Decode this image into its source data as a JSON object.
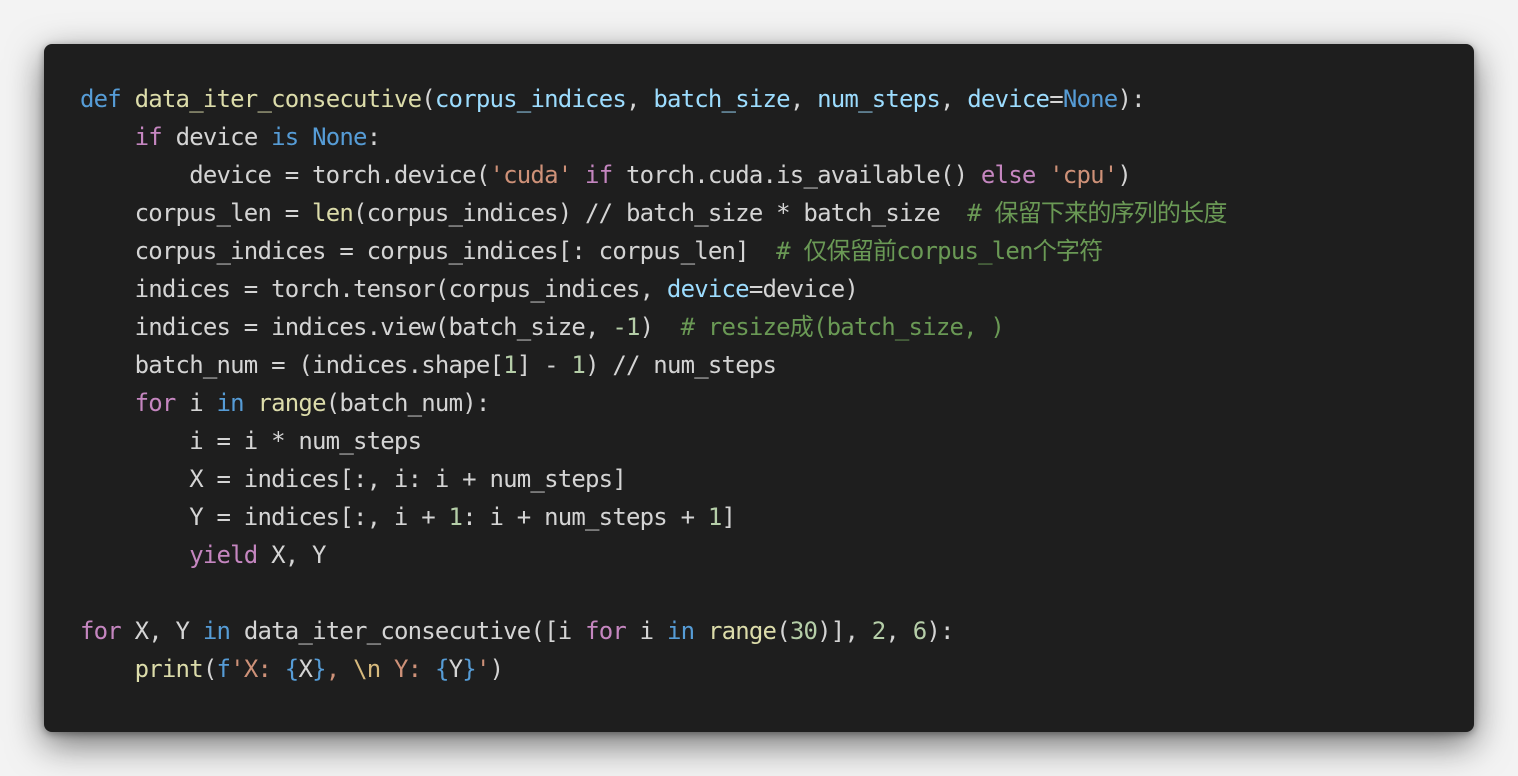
{
  "colors": {
    "page_background": "#f3f3f3",
    "editor_background": "#1e1e1e",
    "default_text": "#d4d4d4",
    "keyword": "#569cd6",
    "control": "#c586c0",
    "function": "#dcdcaa",
    "parameter": "#9cdcfe",
    "string": "#ce9178",
    "number": "#b5cea8",
    "comment": "#6a9955",
    "escape": "#d7ba7d"
  },
  "code": {
    "language": "python",
    "lines": [
      [
        {
          "t": "keyword",
          "v": "def"
        },
        {
          "t": "default",
          "v": " "
        },
        {
          "t": "function",
          "v": "data_iter_consecutive"
        },
        {
          "t": "default",
          "v": "("
        },
        {
          "t": "param",
          "v": "corpus_indices"
        },
        {
          "t": "default",
          "v": ", "
        },
        {
          "t": "param",
          "v": "batch_size"
        },
        {
          "t": "default",
          "v": ", "
        },
        {
          "t": "param",
          "v": "num_steps"
        },
        {
          "t": "default",
          "v": ", "
        },
        {
          "t": "param",
          "v": "device"
        },
        {
          "t": "default",
          "v": "="
        },
        {
          "t": "constant",
          "v": "None"
        },
        {
          "t": "default",
          "v": "):"
        }
      ],
      [
        {
          "t": "default",
          "v": "    "
        },
        {
          "t": "control",
          "v": "if"
        },
        {
          "t": "default",
          "v": " device "
        },
        {
          "t": "keyword",
          "v": "is"
        },
        {
          "t": "default",
          "v": " "
        },
        {
          "t": "constant",
          "v": "None"
        },
        {
          "t": "default",
          "v": ":"
        }
      ],
      [
        {
          "t": "default",
          "v": "        device = torch.device("
        },
        {
          "t": "string",
          "v": "'cuda'"
        },
        {
          "t": "default",
          "v": " "
        },
        {
          "t": "control",
          "v": "if"
        },
        {
          "t": "default",
          "v": " torch.cuda.is_available() "
        },
        {
          "t": "control",
          "v": "else"
        },
        {
          "t": "default",
          "v": " "
        },
        {
          "t": "string",
          "v": "'cpu'"
        },
        {
          "t": "default",
          "v": ")"
        }
      ],
      [
        {
          "t": "default",
          "v": "    corpus_len = "
        },
        {
          "t": "function",
          "v": "len"
        },
        {
          "t": "default",
          "v": "(corpus_indices) // batch_size * batch_size  "
        },
        {
          "t": "comment",
          "v": "# 保留下来的序列的长度"
        }
      ],
      [
        {
          "t": "default",
          "v": "    corpus_indices = corpus_indices[: corpus_len]  "
        },
        {
          "t": "comment",
          "v": "# 仅保留前corpus_len个字符"
        }
      ],
      [
        {
          "t": "default",
          "v": "    indices = torch.tensor(corpus_indices, "
        },
        {
          "t": "param",
          "v": "device"
        },
        {
          "t": "default",
          "v": "=device)"
        }
      ],
      [
        {
          "t": "default",
          "v": "    indices = indices.view(batch_size, "
        },
        {
          "t": "number",
          "v": "-1"
        },
        {
          "t": "default",
          "v": ")  "
        },
        {
          "t": "comment",
          "v": "# resize成(batch_size, )"
        }
      ],
      [
        {
          "t": "default",
          "v": "    batch_num = (indices.shape["
        },
        {
          "t": "number",
          "v": "1"
        },
        {
          "t": "default",
          "v": "] - "
        },
        {
          "t": "number",
          "v": "1"
        },
        {
          "t": "default",
          "v": ") // num_steps"
        }
      ],
      [
        {
          "t": "default",
          "v": "    "
        },
        {
          "t": "control",
          "v": "for"
        },
        {
          "t": "default",
          "v": " i "
        },
        {
          "t": "keyword",
          "v": "in"
        },
        {
          "t": "default",
          "v": " "
        },
        {
          "t": "function",
          "v": "range"
        },
        {
          "t": "default",
          "v": "(batch_num):"
        }
      ],
      [
        {
          "t": "default",
          "v": "        i = i * num_steps"
        }
      ],
      [
        {
          "t": "default",
          "v": "        X = indices[:, i: i + num_steps]"
        }
      ],
      [
        {
          "t": "default",
          "v": "        Y = indices[:, i + "
        },
        {
          "t": "number",
          "v": "1"
        },
        {
          "t": "default",
          "v": ": i + num_steps + "
        },
        {
          "t": "number",
          "v": "1"
        },
        {
          "t": "default",
          "v": "]"
        }
      ],
      [
        {
          "t": "default",
          "v": "        "
        },
        {
          "t": "control",
          "v": "yield"
        },
        {
          "t": "default",
          "v": " X, Y"
        }
      ],
      [
        {
          "t": "default",
          "v": ""
        }
      ],
      [
        {
          "t": "control",
          "v": "for"
        },
        {
          "t": "default",
          "v": " X, Y "
        },
        {
          "t": "keyword",
          "v": "in"
        },
        {
          "t": "default",
          "v": " data_iter_consecutive([i "
        },
        {
          "t": "control",
          "v": "for"
        },
        {
          "t": "default",
          "v": " i "
        },
        {
          "t": "keyword",
          "v": "in"
        },
        {
          "t": "default",
          "v": " "
        },
        {
          "t": "function",
          "v": "range"
        },
        {
          "t": "default",
          "v": "("
        },
        {
          "t": "number",
          "v": "30"
        },
        {
          "t": "default",
          "v": ")], "
        },
        {
          "t": "number",
          "v": "2"
        },
        {
          "t": "default",
          "v": ", "
        },
        {
          "t": "number",
          "v": "6"
        },
        {
          "t": "default",
          "v": "):"
        }
      ],
      [
        {
          "t": "default",
          "v": "    "
        },
        {
          "t": "function",
          "v": "print"
        },
        {
          "t": "default",
          "v": "("
        },
        {
          "t": "keyword",
          "v": "f"
        },
        {
          "t": "string",
          "v": "'X: "
        },
        {
          "t": "brace",
          "v": "{"
        },
        {
          "t": "default",
          "v": "X"
        },
        {
          "t": "brace",
          "v": "}"
        },
        {
          "t": "string",
          "v": ", "
        },
        {
          "t": "escape",
          "v": "\\n"
        },
        {
          "t": "string",
          "v": " Y: "
        },
        {
          "t": "brace",
          "v": "{"
        },
        {
          "t": "default",
          "v": "Y"
        },
        {
          "t": "brace",
          "v": "}"
        },
        {
          "t": "string",
          "v": "'"
        },
        {
          "t": "default",
          "v": ")"
        }
      ]
    ]
  }
}
